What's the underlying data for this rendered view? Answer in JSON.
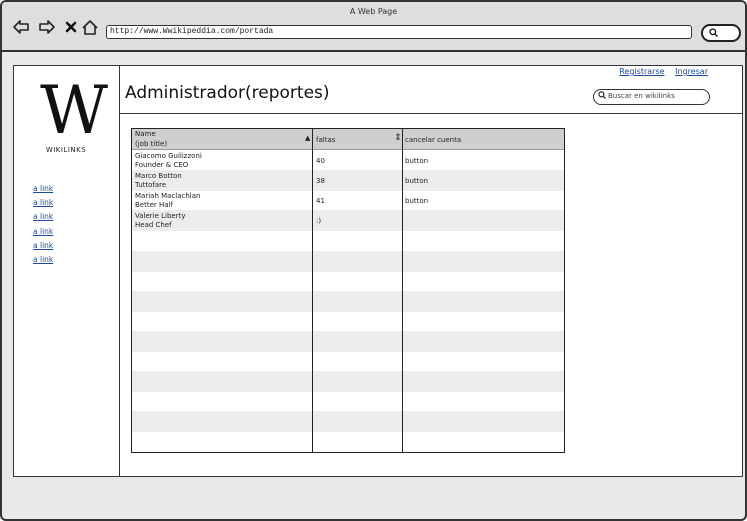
{
  "window": {
    "title": "A Web Page",
    "url": "http://www.Wwikipeddia.com/portada"
  },
  "site": {
    "logo_letter": "W",
    "logo_text": "WIKILINKS",
    "register_link": "Registrarse",
    "login_link": "Ingresar",
    "page_title": "Administrador(reportes)",
    "search_placeholder": "Buscar en wikilinks",
    "sidebar_links": [
      "a link",
      "a link",
      "a link",
      "a link",
      "a link",
      "a link"
    ]
  },
  "table": {
    "columns": [
      {
        "label_line1": "Name",
        "label_line2": "(job title)",
        "sort": "asc"
      },
      {
        "label_line1": "faltas",
        "label_line2": "",
        "sort": "both"
      },
      {
        "label_line1": "cancelar cuenta",
        "label_line2": "",
        "sort": "none"
      }
    ],
    "rows": [
      {
        "name": "Giacomo Guilizzoni",
        "title": "Founder & CEO",
        "faltas": "40",
        "action": "button"
      },
      {
        "name": "Marco Botton",
        "title": "Tuttofare",
        "faltas": "38",
        "action": "button"
      },
      {
        "name": "Mariah Maclachlan",
        "title": "Better Half",
        "faltas": "41",
        "action": "button"
      },
      {
        "name": "Valerie Liberty",
        "title": "Head Chef",
        "faltas": ":)",
        "action": ""
      }
    ]
  },
  "icons": {
    "back": "back-arrow-icon",
    "forward": "forward-arrow-icon",
    "stop": "close-icon",
    "home": "home-icon",
    "search": "search-icon"
  }
}
